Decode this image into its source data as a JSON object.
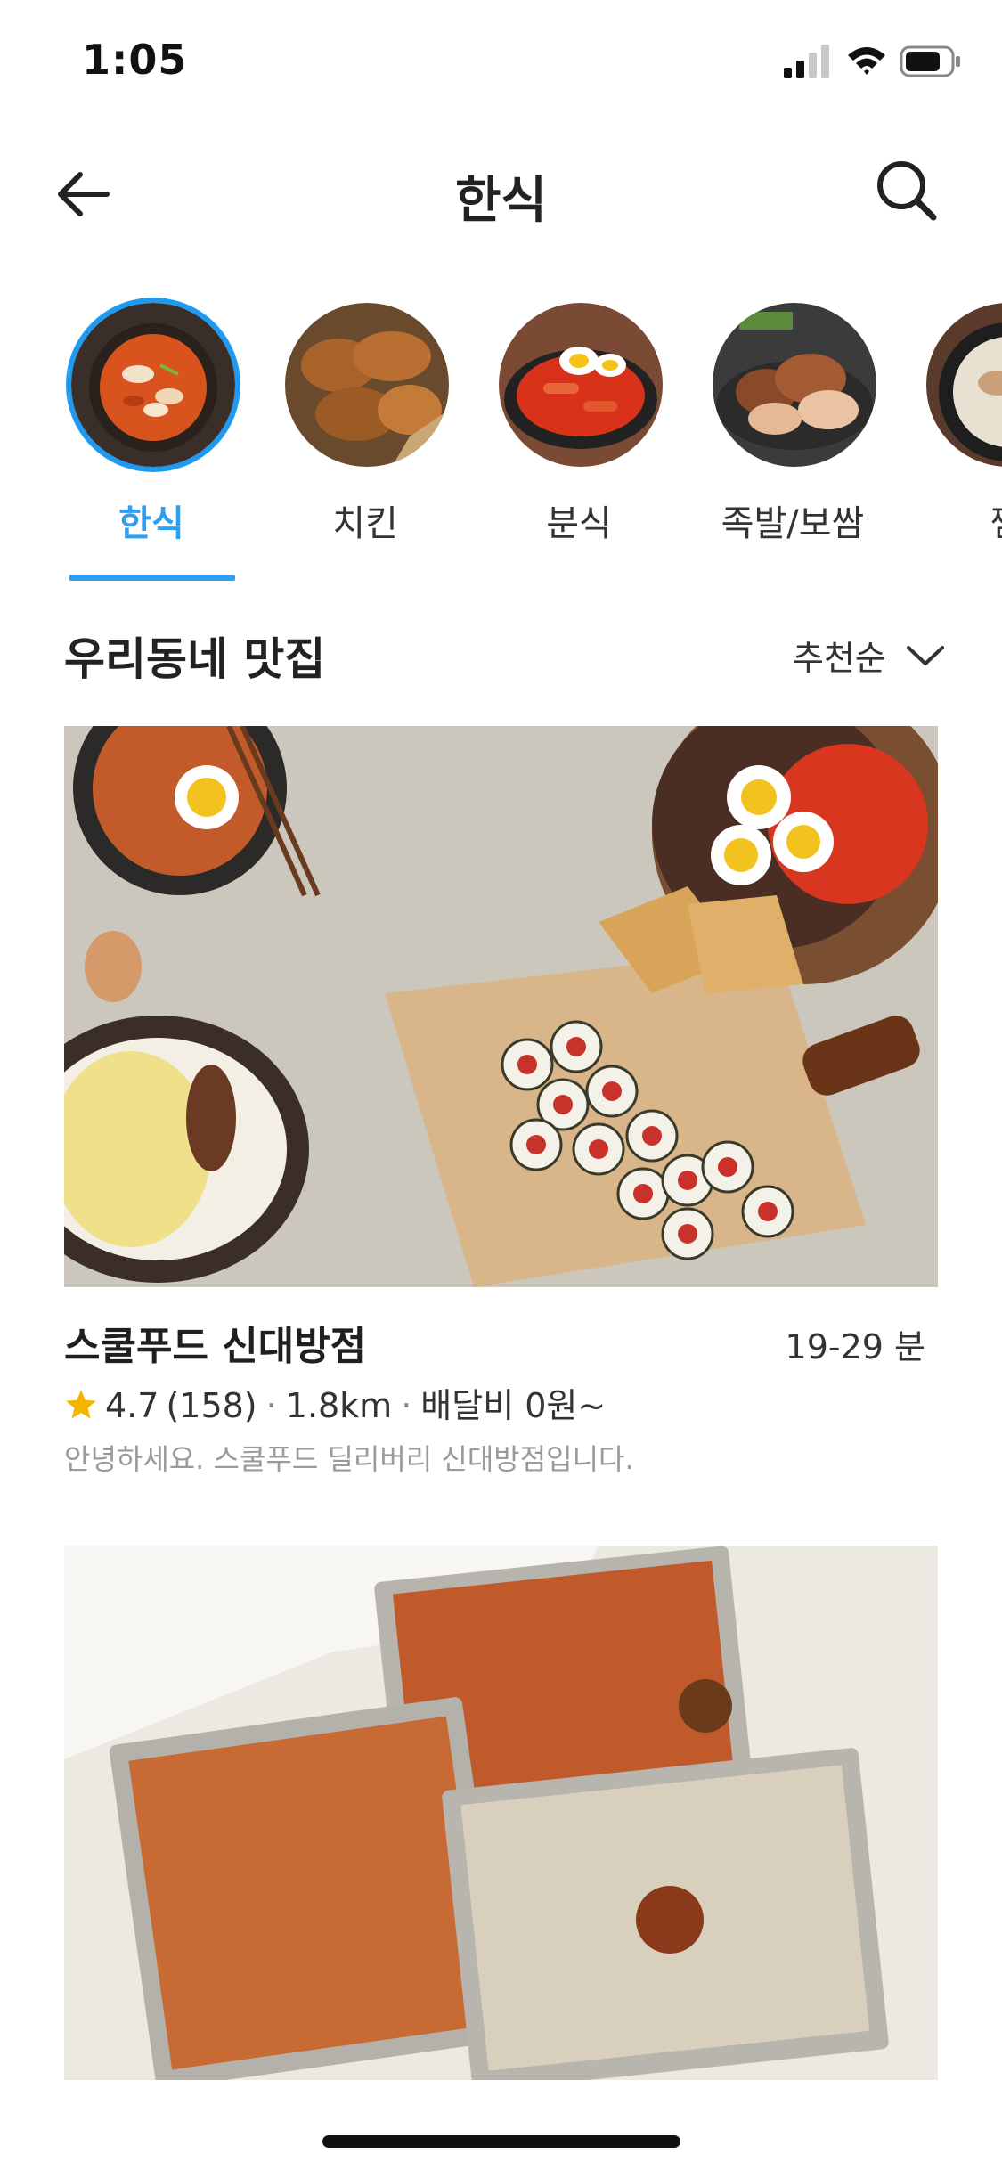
{
  "status_bar": {
    "time": "1:05"
  },
  "nav": {
    "title": "한식"
  },
  "categories": [
    {
      "label": "한식",
      "active": true
    },
    {
      "label": "치킨",
      "active": false
    },
    {
      "label": "분식",
      "active": false
    },
    {
      "label": "족발/보쌈",
      "active": false
    },
    {
      "label": "찜",
      "active": false
    }
  ],
  "section": {
    "title": "우리동네 맛집",
    "sort_label": "추천순"
  },
  "stores": [
    {
      "name": "스쿨푸드 신대방점",
      "delivery_time": "19-29 분",
      "rating": "4.7",
      "review_count": "(158)",
      "distance": "1.8km",
      "delivery_fee": "배달비 0원~",
      "description": "안녕하세요. 스쿨푸드 딜리버리 신대방점입니다."
    },
    {
      "name": ""
    }
  ],
  "colors": {
    "accent": "#2e9ef0",
    "star": "#f5b400"
  },
  "icons": {
    "back": "arrow-left",
    "search": "magnifier",
    "sort": "chevron-down",
    "rating": "star"
  }
}
